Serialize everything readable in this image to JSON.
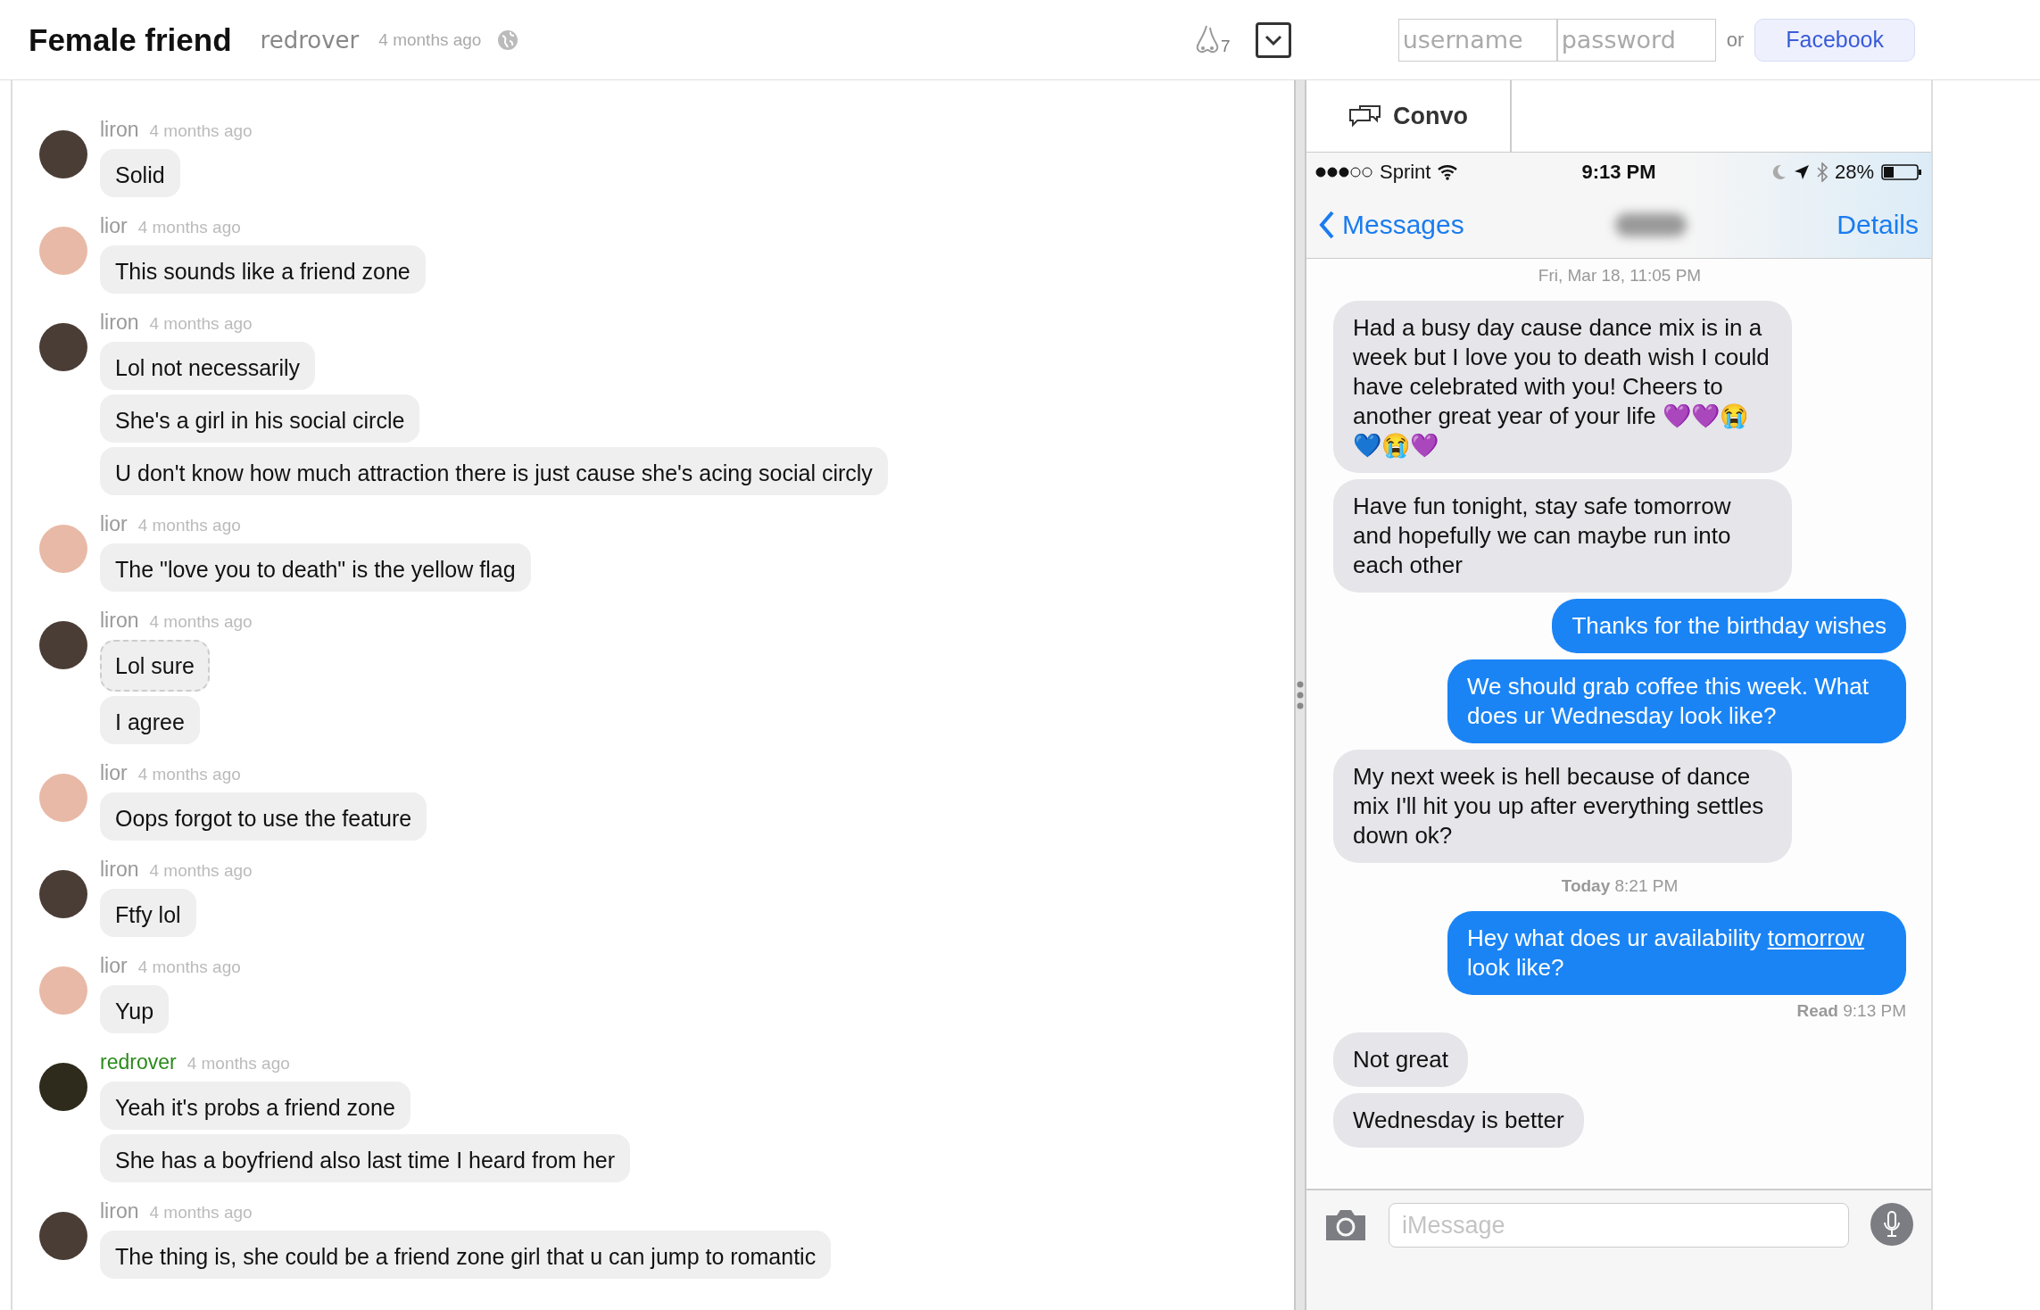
{
  "header": {
    "title": "Female friend",
    "author": "redrover",
    "time": "4 months ago",
    "reaction_count": "7",
    "login": {
      "username_placeholder": "username",
      "password_placeholder": "password",
      "or": "or",
      "facebook": "Facebook"
    }
  },
  "conversation": [
    {
      "author": "liron",
      "time": "4 months ago",
      "color": "#4a3d36",
      "op": false,
      "messages": [
        {
          "text": "Solid",
          "highlighted": false
        }
      ]
    },
    {
      "author": "lior",
      "time": "4 months ago",
      "color": "#e8b9a6",
      "op": false,
      "messages": [
        {
          "text": "This sounds like a friend zone",
          "highlighted": false
        }
      ]
    },
    {
      "author": "liron",
      "time": "4 months ago",
      "color": "#4a3d36",
      "op": false,
      "messages": [
        {
          "text": "Lol not necessarily",
          "highlighted": false
        },
        {
          "text": "She's a girl in his social circle",
          "highlighted": false
        },
        {
          "text": "U don't know how much attraction there is just cause she's acing social circly",
          "highlighted": false
        }
      ]
    },
    {
      "author": "lior",
      "time": "4 months ago",
      "color": "#e8b9a6",
      "op": false,
      "messages": [
        {
          "text": "The \"love you to death\" is the yellow flag",
          "highlighted": false
        }
      ]
    },
    {
      "author": "liron",
      "time": "4 months ago",
      "color": "#4a3d36",
      "op": false,
      "messages": [
        {
          "text": "Lol sure",
          "highlighted": true
        },
        {
          "text": "I agree",
          "highlighted": false
        }
      ]
    },
    {
      "author": "lior",
      "time": "4 months ago",
      "color": "#e8b9a6",
      "op": false,
      "messages": [
        {
          "text": "Oops forgot to use the feature",
          "highlighted": false
        }
      ]
    },
    {
      "author": "liron",
      "time": "4 months ago",
      "color": "#4a3d36",
      "op": false,
      "messages": [
        {
          "text": "Ftfy lol",
          "highlighted": false
        }
      ]
    },
    {
      "author": "lior",
      "time": "4 months ago",
      "color": "#e8b9a6",
      "op": false,
      "messages": [
        {
          "text": "Yup",
          "highlighted": false
        }
      ]
    },
    {
      "author": "redrover",
      "time": "4 months ago",
      "color": "#2e2a1c",
      "op": true,
      "messages": [
        {
          "text": "Yeah it's probs a friend zone",
          "highlighted": false
        },
        {
          "text": "She has a boyfriend also last time I heard from her",
          "highlighted": false
        }
      ]
    },
    {
      "author": "liron",
      "time": "4 months ago",
      "color": "#4a3d36",
      "op": false,
      "messages": [
        {
          "text": "The thing is, she could be a friend zone girl that u can jump to romantic",
          "highlighted": false
        }
      ]
    }
  ],
  "panel": {
    "tab": "Convo",
    "phone": {
      "status_bar": {
        "carrier": "Sprint",
        "time": "9:13 PM",
        "battery": "28%"
      },
      "nav": {
        "back": "Messages",
        "details": "Details"
      },
      "thread": [
        {
          "kind": "timestamp",
          "text": "Fri, Mar 18, 11:05 PM"
        },
        {
          "kind": "received",
          "parts": [
            {
              "text": "Had a busy day cause dance mix is in a week but I love you to death wish I could have celebrated with you! Cheers to another great year of your life 💜💜😭💙😭💜"
            }
          ]
        },
        {
          "kind": "received",
          "parts": [
            {
              "text": "Have fun tonight, stay safe tomorrow and hopefully we can maybe run into each other"
            }
          ]
        },
        {
          "kind": "sent",
          "parts": [
            {
              "text": "Thanks for the birthday wishes"
            }
          ]
        },
        {
          "kind": "sent",
          "parts": [
            {
              "text": "We should grab coffee this week. What does ur Wednesday look like?"
            }
          ]
        },
        {
          "kind": "received",
          "parts": [
            {
              "text": "My next week is hell because of dance mix  I'll hit you up after everything settles down ok?"
            }
          ]
        },
        {
          "kind": "timestamp",
          "text": "**Today** 8:21 PM"
        },
        {
          "kind": "sent",
          "parts": [
            {
              "text": "Hey what does ur availability "
            },
            {
              "text": "tomorrow",
              "link": true
            },
            {
              "text": " look like?"
            }
          ]
        },
        {
          "kind": "receipt",
          "text": "**Read** 9:13 PM"
        },
        {
          "kind": "received",
          "parts": [
            {
              "text": "Not great"
            }
          ]
        },
        {
          "kind": "received",
          "parts": [
            {
              "text": "Wednesday is better"
            }
          ]
        }
      ],
      "input_placeholder": "iMessage"
    }
  }
}
